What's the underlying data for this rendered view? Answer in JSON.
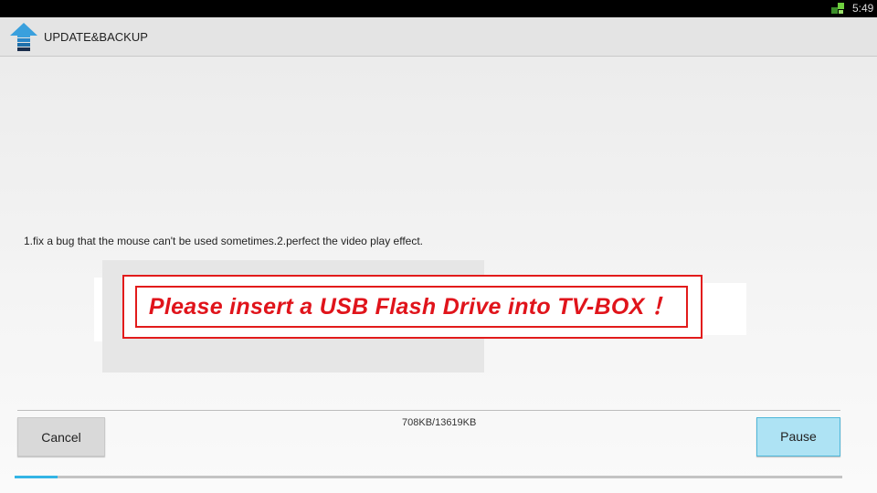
{
  "status_bar": {
    "time": "5:49",
    "icon": "network-icon"
  },
  "app": {
    "title": "UPDATE&BACKUP",
    "icon": "update-arrow-icon"
  },
  "update_notes": "1.fix a bug that the mouse can't be used sometimes.2.perfect the video play effect.",
  "toast": {
    "message": "Please insert a USB Flash Drive into TV-BOX ！",
    "color": "#e0141b"
  },
  "download": {
    "progress_text": "708KB/13619KB",
    "progress_fraction": 0.052
  },
  "buttons": {
    "cancel": "Cancel",
    "pause": "Pause"
  },
  "colors": {
    "accent": "#33b5e5",
    "pause_bg": "#aee3f4"
  }
}
